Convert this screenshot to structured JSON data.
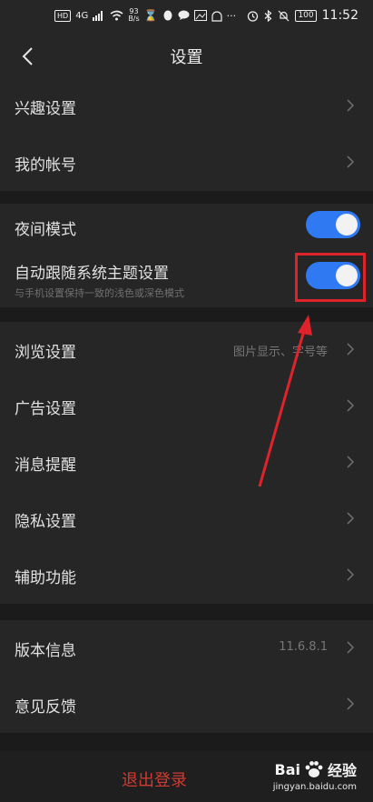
{
  "status_bar": {
    "hd_label": "HD",
    "network_label": "4G",
    "speed_value": "93",
    "speed_unit": "B/s",
    "battery": "100",
    "time": "11:52",
    "more": "···"
  },
  "header": {
    "title": "设置"
  },
  "group1": [
    {
      "label": "兴趣设置"
    },
    {
      "label": "我的帐号"
    }
  ],
  "group2": {
    "night_mode": {
      "label": "夜间模式",
      "on": true
    },
    "follow_system": {
      "label": "自动跟随系统主题设置",
      "subtitle": "与手机设置保持一致的浅色或深色模式",
      "on": true
    }
  },
  "group3": [
    {
      "label": "浏览设置",
      "value": "图片显示、字号等"
    },
    {
      "label": "广告设置"
    },
    {
      "label": "消息提醒"
    },
    {
      "label": "隐私设置"
    },
    {
      "label": "辅助功能"
    }
  ],
  "group4": [
    {
      "label": "版本信息",
      "value": "11.6.8.1"
    },
    {
      "label": "意见反馈"
    }
  ],
  "logout": {
    "label": "退出登录"
  },
  "watermark": {
    "brand": "Bai",
    "brand2": "经验",
    "url": "jingyan.baidu.com"
  },
  "colors": {
    "accent": "#2f79f2",
    "highlight": "#e0222a",
    "logout": "#d03a32"
  }
}
